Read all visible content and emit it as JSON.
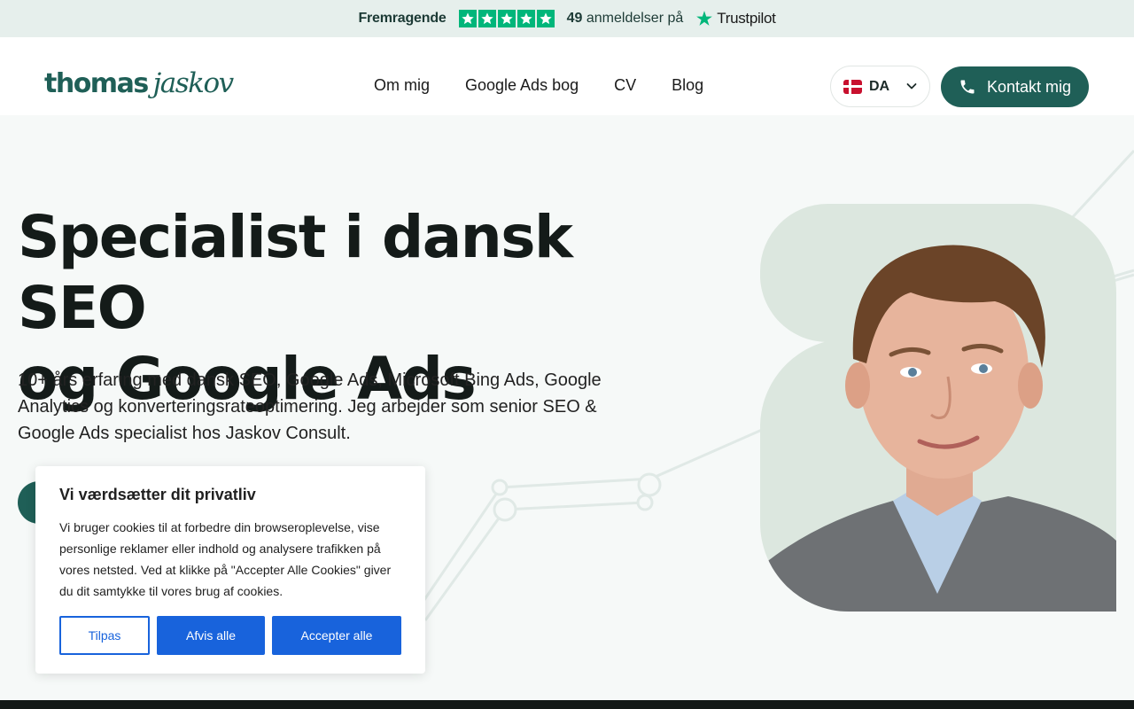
{
  "trustbar": {
    "rating_label": "Fremragende",
    "review_count": "49",
    "review_text": "anmeldelser på",
    "brand": "Trustpilot",
    "star_count": 5,
    "brand_color": "#00b67a"
  },
  "header": {
    "logo_part1": "thomas",
    "logo_part2": "jaskov",
    "nav": [
      {
        "label": "Om mig"
      },
      {
        "label": "Google Ads bog"
      },
      {
        "label": "CV"
      },
      {
        "label": "Blog"
      }
    ],
    "language": "DA",
    "contact_label": "Kontakt mig",
    "accent_color": "#1f5f57"
  },
  "hero": {
    "title_line1": "Specialist i dansk SEO",
    "title_line2": "og Google Ads",
    "subtitle": "10+ års erfaring med dansk SEO, Google Ads, Microsoft Bing Ads, Google Analytics og konverteringsrateoptimering. Jeg arbejder som senior SEO & Google Ads specialist hos Jaskov Consult."
  },
  "cookie": {
    "title": "Vi værdsætter dit privatliv",
    "text": "Vi bruger cookies til at forbedre din browseroplevelse, vise personlige reklamer eller indhold og analysere trafikken på vores netsted. Ved at klikke på \"Accepter Alle Cookies\" giver du dit samtykke til vores brug af cookies.",
    "customize_label": "Tilpas",
    "reject_label": "Afvis alle",
    "accept_label": "Accepter alle",
    "button_color": "#1863dc"
  }
}
